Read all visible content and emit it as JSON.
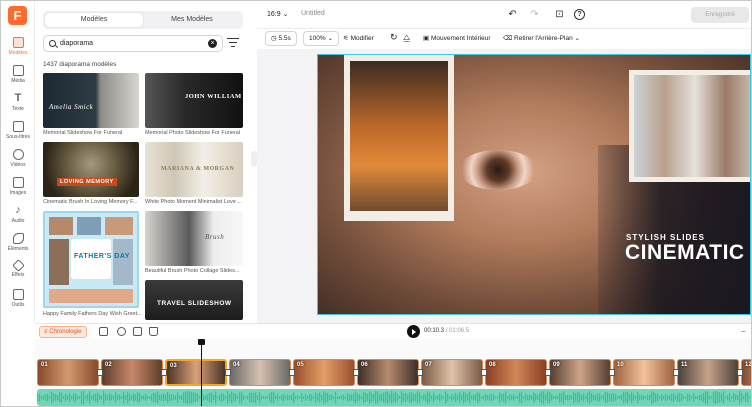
{
  "app": {
    "logo_letter": "F",
    "brand_color": "#ff6b2c"
  },
  "rail": {
    "items": [
      {
        "label": "Modèles",
        "icon": "templates-icon",
        "active": true
      },
      {
        "label": "Média",
        "icon": "media-icon"
      },
      {
        "label": "Texte",
        "icon": "text-icon"
      },
      {
        "label": "Sous-titres",
        "icon": "subtitles-icon"
      },
      {
        "label": "Vidéos",
        "icon": "videos-icon"
      },
      {
        "label": "Images",
        "icon": "images-icon"
      },
      {
        "label": "Audio",
        "icon": "audio-icon"
      },
      {
        "label": "Éléments",
        "icon": "elements-icon"
      },
      {
        "label": "Effets",
        "icon": "effects-icon"
      },
      {
        "label": "Outils",
        "icon": "tools-icon"
      }
    ]
  },
  "panel": {
    "tabs": [
      "Modèles",
      "Mes Modèles"
    ],
    "search_value": "diaporama",
    "count": "1437 diaporama modèles",
    "templates": [
      {
        "caption": "Memorial Slideshow For Funeral",
        "label": "Amelia Smick"
      },
      {
        "caption": "Memorial Photo Slideshow For Funeral",
        "label": "JOHN WILLIAM"
      },
      {
        "caption": "Cinematic Brush In Loving Memory F...",
        "label": "LOVING MEMORY"
      },
      {
        "caption": "White Photo Moment Minimalist Love ...",
        "label": "MARIANA & MORGAN"
      },
      {
        "caption": "Happy Family Fathers Day Wish Greet...",
        "label": "FATHER'S DAY"
      },
      {
        "caption": "Beautiful Brush Photo Collage Slides...",
        "label": "Brush"
      },
      {
        "caption": "",
        "label": "TRAVEL SLIDESHOW"
      }
    ]
  },
  "topbar": {
    "ratio": "16:9",
    "project_title": "Untitled",
    "export_label": "Enregistré"
  },
  "toolbar": {
    "duration": "5.5s",
    "zoom": "100%",
    "modify": "Modifier",
    "movement": "Mouvement Intérieur",
    "remove_bg": "Retirer l'Arrière-Plan"
  },
  "canvas": {
    "tagline": "STYLISH SLIDES",
    "headline": "CINEMATIC"
  },
  "timeline": {
    "chrono_label": "Chronologie",
    "current_time": "00:10.3",
    "total_time": "/ 01:06.5",
    "clips": [
      "01",
      "02",
      "03",
      "04",
      "05",
      "06",
      "07",
      "08",
      "09",
      "10",
      "11",
      "12"
    ]
  }
}
